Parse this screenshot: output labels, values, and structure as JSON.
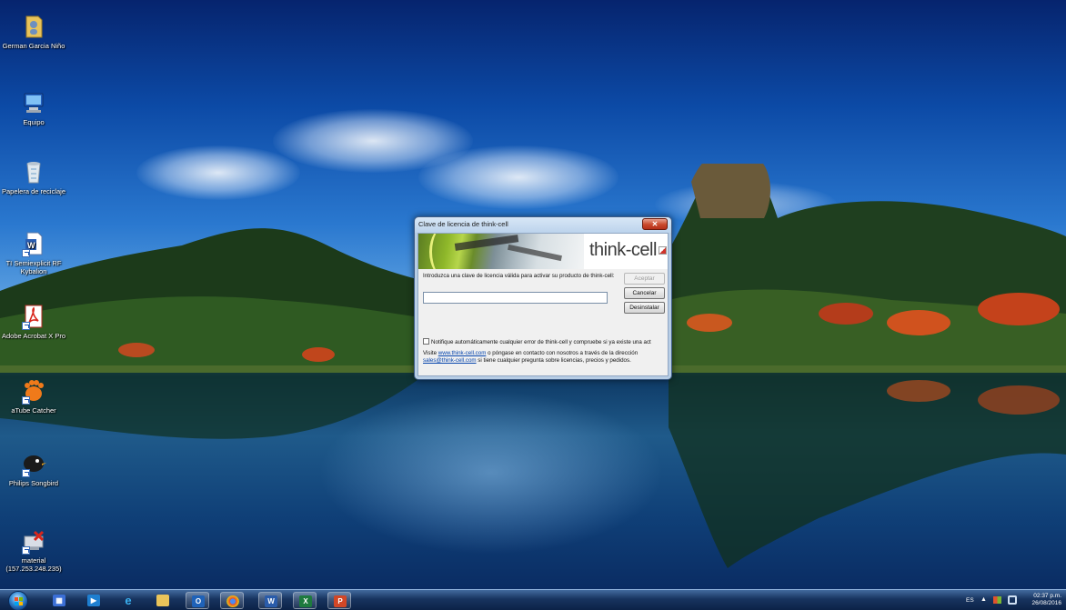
{
  "desktop": {
    "icons": [
      {
        "label": "German Garcia Niño",
        "icon": "user-folder-icon"
      },
      {
        "label": "Equipo",
        "icon": "computer-icon"
      },
      {
        "label": "Papelera de reciclaje",
        "icon": "recycle-bin-icon"
      },
      {
        "label": "TI Semiexplicit RF Kybalion",
        "icon": "word-document-icon"
      },
      {
        "label": "Adobe Acrobat X Pro",
        "icon": "acrobat-icon"
      },
      {
        "label": "aTube Catcher",
        "icon": "atube-catcher-icon"
      },
      {
        "label": "Philips Songbird",
        "icon": "songbird-icon"
      },
      {
        "label": "material (157.253.248.235)",
        "icon": "network-folder-icon"
      }
    ]
  },
  "dialog": {
    "title": "Clave de licencia de think-cell",
    "logo_text": "think-cell",
    "prompt": "Introduzca una clave de licencia válida para activar su producto de think-cell:",
    "license_key_value": "",
    "accept_label": "Aceptar",
    "cancel_label": "Cancelar",
    "uninstall_label": "Desinstalar",
    "checkbox_label": "Notifique automáticamente cualquier error de think-cell y compruebe si ya existe una act",
    "checkbox_checked": false,
    "info_prefix": "Visite ",
    "website_link": "www.think-cell.com",
    "info_middle": " o póngase en contacto con nosotros a través de la dirección ",
    "email_link": "sales@think-cell.com",
    "info_suffix": " si tiene cualquier pregunta sobre licencias, precios y pedidos.",
    "close_symbol": "✕"
  },
  "taskbar": {
    "items": [
      {
        "icon": "apps-icon",
        "color": "#3b6fd6"
      },
      {
        "icon": "media-icon",
        "color": "#1e7fd1"
      },
      {
        "icon": "internet-explorer-icon",
        "color": "#2aa0e8"
      },
      {
        "icon": "file-explorer-icon",
        "color": "#e9c45a"
      },
      {
        "icon": "outlook-icon",
        "color": "#1f62b8"
      },
      {
        "icon": "chrome-icon",
        "color": "#e34a2e"
      },
      {
        "icon": "word-icon",
        "color": "#2a5caa"
      },
      {
        "icon": "excel-icon",
        "color": "#1e7a3e"
      },
      {
        "icon": "powerpoint-icon",
        "color": "#d24726"
      }
    ],
    "language": "ES",
    "tray_arrow": "▲",
    "time": "02:37 p.m.",
    "date": "26/08/2016"
  }
}
